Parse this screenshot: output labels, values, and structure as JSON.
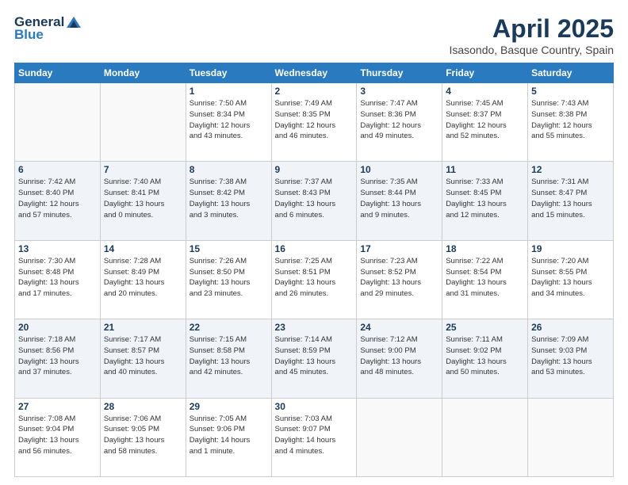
{
  "logo": {
    "general": "General",
    "blue": "Blue"
  },
  "header": {
    "title": "April 2025",
    "location": "Isasondo, Basque Country, Spain"
  },
  "weekdays": [
    "Sunday",
    "Monday",
    "Tuesday",
    "Wednesday",
    "Thursday",
    "Friday",
    "Saturday"
  ],
  "weeks": [
    [
      {
        "day": "",
        "detail": ""
      },
      {
        "day": "",
        "detail": ""
      },
      {
        "day": "1",
        "detail": "Sunrise: 7:50 AM\nSunset: 8:34 PM\nDaylight: 12 hours\nand 43 minutes."
      },
      {
        "day": "2",
        "detail": "Sunrise: 7:49 AM\nSunset: 8:35 PM\nDaylight: 12 hours\nand 46 minutes."
      },
      {
        "day": "3",
        "detail": "Sunrise: 7:47 AM\nSunset: 8:36 PM\nDaylight: 12 hours\nand 49 minutes."
      },
      {
        "day": "4",
        "detail": "Sunrise: 7:45 AM\nSunset: 8:37 PM\nDaylight: 12 hours\nand 52 minutes."
      },
      {
        "day": "5",
        "detail": "Sunrise: 7:43 AM\nSunset: 8:38 PM\nDaylight: 12 hours\nand 55 minutes."
      }
    ],
    [
      {
        "day": "6",
        "detail": "Sunrise: 7:42 AM\nSunset: 8:40 PM\nDaylight: 12 hours\nand 57 minutes."
      },
      {
        "day": "7",
        "detail": "Sunrise: 7:40 AM\nSunset: 8:41 PM\nDaylight: 13 hours\nand 0 minutes."
      },
      {
        "day": "8",
        "detail": "Sunrise: 7:38 AM\nSunset: 8:42 PM\nDaylight: 13 hours\nand 3 minutes."
      },
      {
        "day": "9",
        "detail": "Sunrise: 7:37 AM\nSunset: 8:43 PM\nDaylight: 13 hours\nand 6 minutes."
      },
      {
        "day": "10",
        "detail": "Sunrise: 7:35 AM\nSunset: 8:44 PM\nDaylight: 13 hours\nand 9 minutes."
      },
      {
        "day": "11",
        "detail": "Sunrise: 7:33 AM\nSunset: 8:45 PM\nDaylight: 13 hours\nand 12 minutes."
      },
      {
        "day": "12",
        "detail": "Sunrise: 7:31 AM\nSunset: 8:47 PM\nDaylight: 13 hours\nand 15 minutes."
      }
    ],
    [
      {
        "day": "13",
        "detail": "Sunrise: 7:30 AM\nSunset: 8:48 PM\nDaylight: 13 hours\nand 17 minutes."
      },
      {
        "day": "14",
        "detail": "Sunrise: 7:28 AM\nSunset: 8:49 PM\nDaylight: 13 hours\nand 20 minutes."
      },
      {
        "day": "15",
        "detail": "Sunrise: 7:26 AM\nSunset: 8:50 PM\nDaylight: 13 hours\nand 23 minutes."
      },
      {
        "day": "16",
        "detail": "Sunrise: 7:25 AM\nSunset: 8:51 PM\nDaylight: 13 hours\nand 26 minutes."
      },
      {
        "day": "17",
        "detail": "Sunrise: 7:23 AM\nSunset: 8:52 PM\nDaylight: 13 hours\nand 29 minutes."
      },
      {
        "day": "18",
        "detail": "Sunrise: 7:22 AM\nSunset: 8:54 PM\nDaylight: 13 hours\nand 31 minutes."
      },
      {
        "day": "19",
        "detail": "Sunrise: 7:20 AM\nSunset: 8:55 PM\nDaylight: 13 hours\nand 34 minutes."
      }
    ],
    [
      {
        "day": "20",
        "detail": "Sunrise: 7:18 AM\nSunset: 8:56 PM\nDaylight: 13 hours\nand 37 minutes."
      },
      {
        "day": "21",
        "detail": "Sunrise: 7:17 AM\nSunset: 8:57 PM\nDaylight: 13 hours\nand 40 minutes."
      },
      {
        "day": "22",
        "detail": "Sunrise: 7:15 AM\nSunset: 8:58 PM\nDaylight: 13 hours\nand 42 minutes."
      },
      {
        "day": "23",
        "detail": "Sunrise: 7:14 AM\nSunset: 8:59 PM\nDaylight: 13 hours\nand 45 minutes."
      },
      {
        "day": "24",
        "detail": "Sunrise: 7:12 AM\nSunset: 9:00 PM\nDaylight: 13 hours\nand 48 minutes."
      },
      {
        "day": "25",
        "detail": "Sunrise: 7:11 AM\nSunset: 9:02 PM\nDaylight: 13 hours\nand 50 minutes."
      },
      {
        "day": "26",
        "detail": "Sunrise: 7:09 AM\nSunset: 9:03 PM\nDaylight: 13 hours\nand 53 minutes."
      }
    ],
    [
      {
        "day": "27",
        "detail": "Sunrise: 7:08 AM\nSunset: 9:04 PM\nDaylight: 13 hours\nand 56 minutes."
      },
      {
        "day": "28",
        "detail": "Sunrise: 7:06 AM\nSunset: 9:05 PM\nDaylight: 13 hours\nand 58 minutes."
      },
      {
        "day": "29",
        "detail": "Sunrise: 7:05 AM\nSunset: 9:06 PM\nDaylight: 14 hours\nand 1 minute."
      },
      {
        "day": "30",
        "detail": "Sunrise: 7:03 AM\nSunset: 9:07 PM\nDaylight: 14 hours\nand 4 minutes."
      },
      {
        "day": "",
        "detail": ""
      },
      {
        "day": "",
        "detail": ""
      },
      {
        "day": "",
        "detail": ""
      }
    ]
  ]
}
